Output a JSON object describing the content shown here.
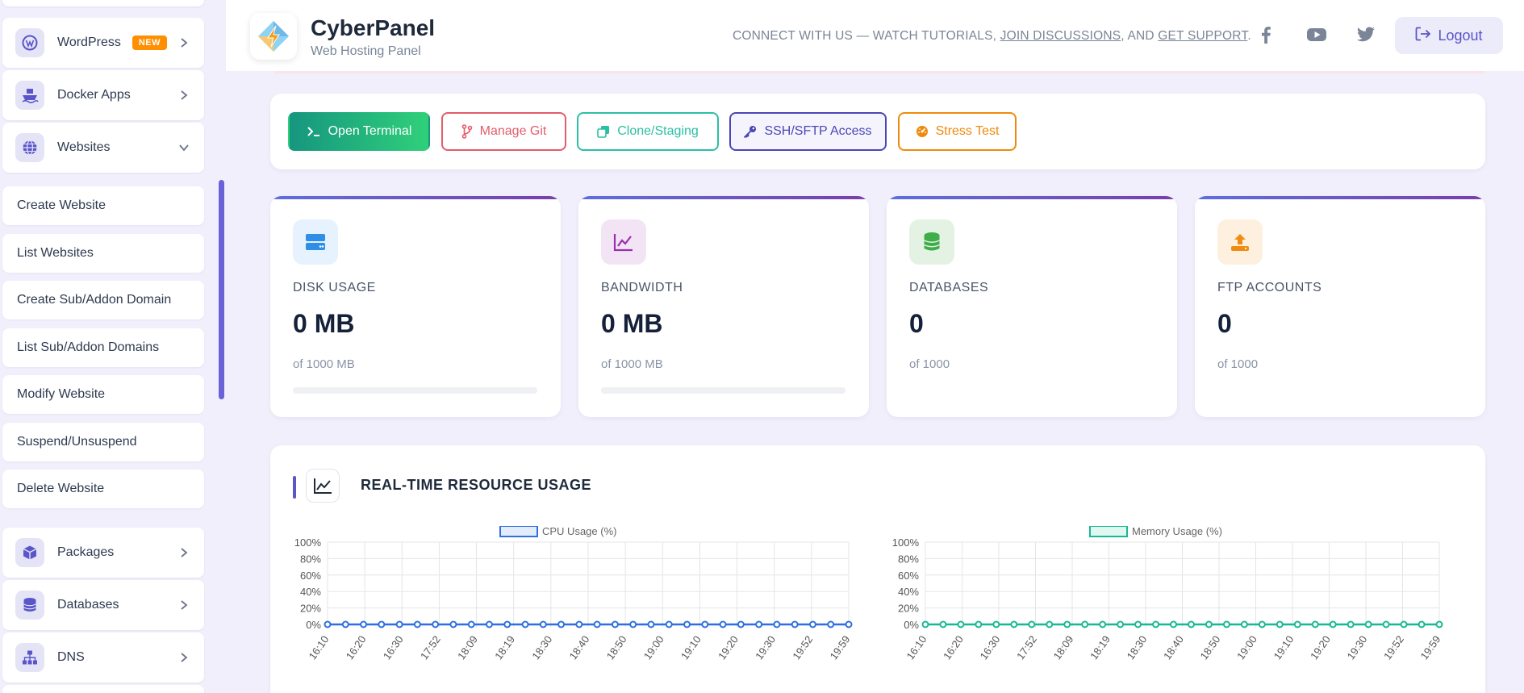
{
  "sidebar": {
    "top_items": [
      {
        "label": "WordPress",
        "badge": "NEW",
        "icon": "wordpress-icon"
      },
      {
        "label": "Docker Apps",
        "icon": "docker-ship-icon"
      },
      {
        "label": "Websites",
        "icon": "globe-icon"
      }
    ],
    "websites_submenu": [
      "Create Website",
      "List Websites",
      "Create Sub/Addon Domain",
      "List Sub/Addon Domains",
      "Modify Website",
      "Suspend/Unsuspend",
      "Delete Website"
    ],
    "bottom_items": [
      {
        "label": "Packages",
        "icon": "cube-icon"
      },
      {
        "label": "Databases",
        "icon": "database-icon"
      },
      {
        "label": "DNS",
        "icon": "sitemap-icon"
      }
    ]
  },
  "header": {
    "brand": "CyberPanel",
    "subtitle": "Web Hosting Panel",
    "connect_prefix": "CONNECT WITH US — WATCH TUTORIALS, ",
    "connect_link1": "JOIN DISCUSSIONS",
    "connect_mid": ", AND ",
    "connect_link2": "GET SUPPORT",
    "connect_suffix": ".",
    "logout": "Logout"
  },
  "actions": [
    {
      "label": "Open Terminal",
      "icon": "terminal-icon",
      "color": "#1a9a83"
    },
    {
      "label": "Manage Git",
      "icon": "git-branch-icon",
      "color": "#e35d6a"
    },
    {
      "label": "Clone/Staging",
      "icon": "clone-icon",
      "color": "#2bbfa5"
    },
    {
      "label": "SSH/SFTP Access",
      "icon": "key-icon",
      "color": "#4b46b5"
    },
    {
      "label": "Stress Test",
      "icon": "gauge-icon",
      "color": "#ef8a0c"
    }
  ],
  "stats": [
    {
      "label": "DISK USAGE",
      "value": "0 MB",
      "of": "of 1000 MB",
      "icon": "hdd-icon",
      "progress": 0
    },
    {
      "label": "BANDWIDTH",
      "value": "0 MB",
      "of": "of 1000 MB",
      "icon": "line-chart-icon",
      "progress": 0
    },
    {
      "label": "DATABASES",
      "value": "0",
      "of": "of 1000",
      "icon": "database-icon"
    },
    {
      "label": "FTP ACCOUNTS",
      "value": "0",
      "of": "of 1000",
      "icon": "upload-icon"
    }
  ],
  "resource": {
    "title": "REAL-TIME RESOURCE USAGE"
  },
  "chart_data": [
    {
      "type": "line",
      "series": [
        {
          "name": "CPU Usage (%)",
          "color": "#2f6fe0",
          "values": [
            0,
            0,
            0,
            0,
            0,
            0,
            0,
            0,
            0,
            0,
            0,
            0,
            0,
            0,
            0,
            0,
            0,
            0,
            0,
            0,
            0,
            0,
            0,
            0,
            0,
            0,
            0,
            0,
            0,
            0
          ]
        }
      ],
      "x": [
        "16:10",
        "16:20",
        "16:30",
        "17:52",
        "18:09",
        "18:19",
        "18:30",
        "18:40",
        "18:50",
        "19:00",
        "19:10",
        "19:20",
        "19:30",
        "19:52",
        "19:59"
      ],
      "y_ticks": [
        "100%",
        "80%",
        "60%",
        "40%",
        "20%",
        "0%"
      ],
      "ylim": [
        0,
        100
      ]
    },
    {
      "type": "line",
      "series": [
        {
          "name": "Memory Usage (%)",
          "color": "#18b894",
          "values": [
            0,
            0,
            0,
            0,
            0,
            0,
            0,
            0,
            0,
            0,
            0,
            0,
            0,
            0,
            0,
            0,
            0,
            0,
            0,
            0,
            0,
            0,
            0,
            0,
            0,
            0,
            0,
            0,
            0,
            0
          ]
        }
      ],
      "x": [
        "16:10",
        "16:20",
        "16:30",
        "17:52",
        "18:09",
        "18:19",
        "18:30",
        "18:40",
        "18:50",
        "19:00",
        "19:10",
        "19:20",
        "19:30",
        "19:52",
        "19:59"
      ],
      "y_ticks": [
        "100%",
        "80%",
        "60%",
        "40%",
        "20%",
        "0%"
      ],
      "ylim": [
        0,
        100
      ]
    }
  ]
}
